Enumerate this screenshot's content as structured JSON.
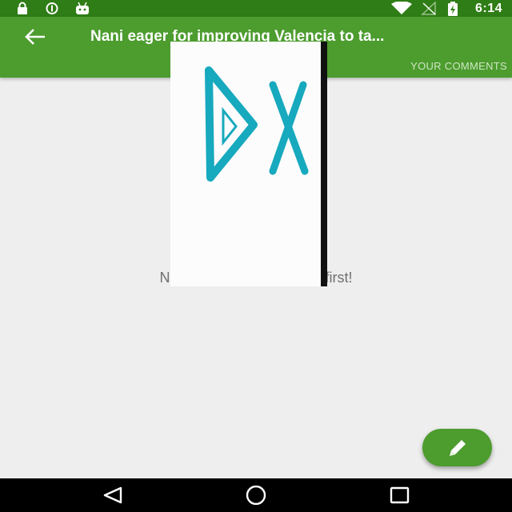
{
  "status_bar": {
    "time": "6:14",
    "background_color": "#2f7d16",
    "icons_left": [
      "lock-icon",
      "sync-icon",
      "android-icon"
    ],
    "icons_right": [
      "wifi-icon",
      "no-signal-icon",
      "battery-charging-icon"
    ]
  },
  "app_bar": {
    "title": "Nani eager for improving Valencia to ta...",
    "tab_label": "YOUR COMMENTS",
    "background_color": "#4c9c2e",
    "back_icon": "arrow-left-icon"
  },
  "main": {
    "empty_message": "No comments yet. Be the first!",
    "background_color": "#eeeeee"
  },
  "overlay": {
    "logo_icon": "play-x-logo",
    "accent_color": "#17a9be"
  },
  "fab": {
    "icon": "pencil-icon",
    "background_color": "#4c9c2e"
  },
  "nav_bar": {
    "icons": [
      "back-triangle-icon",
      "home-circle-icon",
      "recents-square-icon"
    ]
  }
}
